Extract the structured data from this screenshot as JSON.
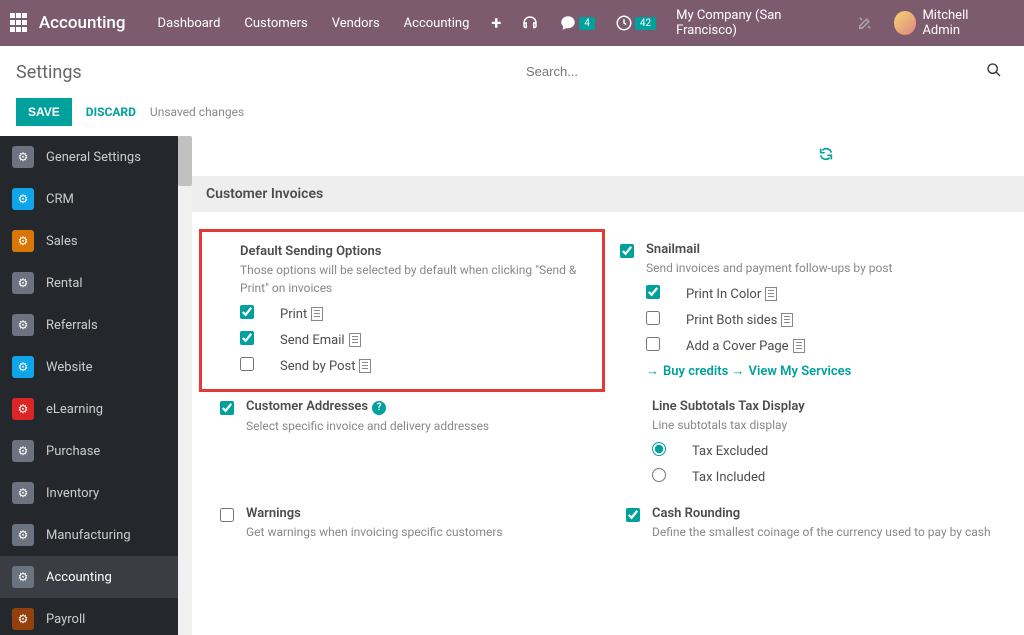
{
  "topnav": {
    "appname": "Accounting",
    "menu": [
      "Dashboard",
      "Customers",
      "Vendors",
      "Accounting"
    ],
    "msgcount": "4",
    "activitycount": "42",
    "company": "My Company (San Francisco)",
    "user": "Mitchell Admin"
  },
  "controls": {
    "pagetitle": "Settings",
    "search_placeholder": "Search...",
    "save": "SAVE",
    "discard": "DISCARD",
    "unsaved": "Unsaved changes"
  },
  "sidebar": [
    {
      "label": "General Settings",
      "color": "#6B7280"
    },
    {
      "label": "CRM",
      "color": "#0EA5E9"
    },
    {
      "label": "Sales",
      "color": "#D97706"
    },
    {
      "label": "Rental",
      "color": "#6B7280"
    },
    {
      "label": "Referrals",
      "color": "#6B7280"
    },
    {
      "label": "Website",
      "color": "#0EA5E9"
    },
    {
      "label": "eLearning",
      "color": "#DC2626"
    },
    {
      "label": "Purchase",
      "color": "#6B7280"
    },
    {
      "label": "Inventory",
      "color": "#6B7280"
    },
    {
      "label": "Manufacturing",
      "color": "#6B7280"
    },
    {
      "label": "Accounting",
      "color": "#6B7280",
      "active": true
    },
    {
      "label": "Payroll",
      "color": "#92400E"
    }
  ],
  "section_header": "Customer Invoices",
  "blocks": {
    "sending": {
      "title": "Default Sending Options",
      "desc": "Those options will be selected by default when clicking \"Send & Print\" on invoices",
      "opts": [
        {
          "label": "Print",
          "checked": true
        },
        {
          "label": "Send Email",
          "checked": true
        },
        {
          "label": "Send by Post",
          "checked": false
        }
      ]
    },
    "snailmail": {
      "title": "Snailmail",
      "desc": "Send invoices and payment follow-ups by post",
      "checked": true,
      "opts": [
        {
          "label": "Print In Color",
          "checked": true
        },
        {
          "label": "Print Both sides",
          "checked": false
        },
        {
          "label": "Add a Cover Page",
          "checked": false
        }
      ],
      "links": [
        "Buy credits",
        "View My Services"
      ]
    },
    "addresses": {
      "title": "Customer Addresses",
      "desc": "Select specific invoice and delivery addresses",
      "checked": true
    },
    "tax": {
      "title": "Line Subtotals Tax Display",
      "desc": "Line subtotals tax display",
      "opts": [
        {
          "label": "Tax Excluded",
          "checked": true
        },
        {
          "label": "Tax Included",
          "checked": false
        }
      ]
    },
    "warnings": {
      "title": "Warnings",
      "desc": "Get warnings when invoicing specific customers",
      "checked": false
    },
    "rounding": {
      "title": "Cash Rounding",
      "desc": "Define the smallest coinage of the currency used to pay by cash",
      "checked": true
    }
  }
}
